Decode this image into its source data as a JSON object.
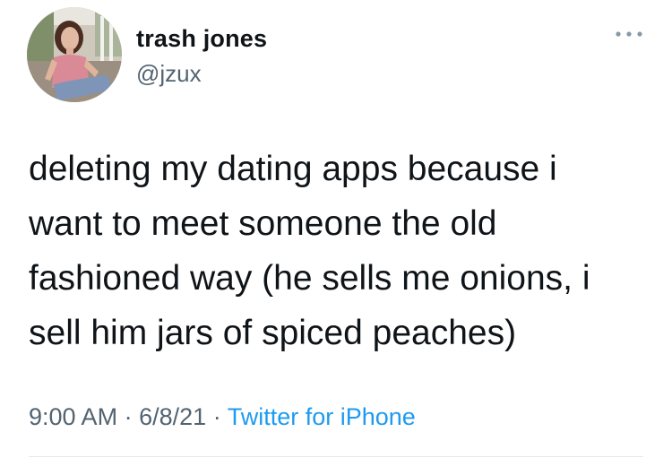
{
  "author": {
    "display_name": "trash jones",
    "handle": "@jzux",
    "avatar_icon": "profile-photo"
  },
  "tweet": {
    "text": "deleting my dating apps because i\nwant to meet someone the old\nfashioned way (he sells me onions, i\nsell him jars of spiced peaches)",
    "time": "9:00 AM",
    "separator": "·",
    "date": "6/8/21",
    "source": "Twitter for iPhone"
  },
  "menu": {
    "icon": "more-dots-icon"
  },
  "colors": {
    "text_primary": "#0f1419",
    "text_secondary": "#536471",
    "link": "#1d9bf0",
    "divider": "#e1e8ed"
  }
}
